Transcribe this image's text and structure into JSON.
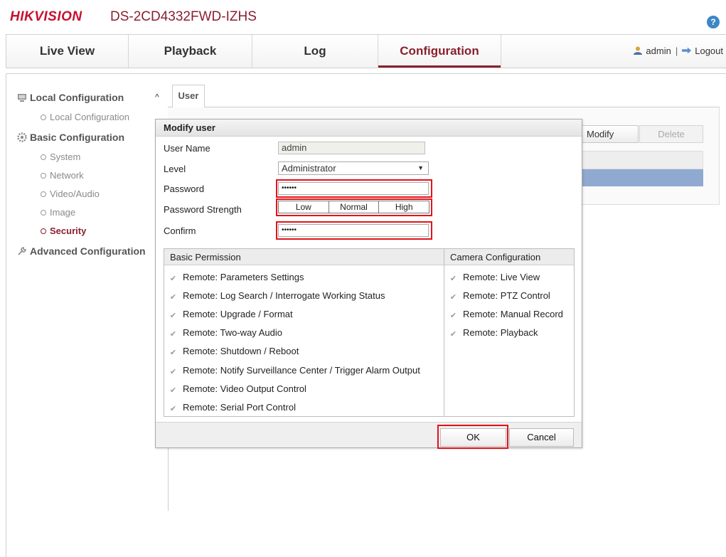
{
  "header": {
    "brand": "HIKVISION",
    "model": "DS-2CD4332FWD-IZHS",
    "help_label": "?"
  },
  "nav": {
    "tabs": [
      "Live View",
      "Playback",
      "Log",
      "Configuration"
    ],
    "active_tab": "Configuration",
    "user": "admin",
    "separator": "|",
    "logout": "Logout"
  },
  "sidebar": {
    "sections": [
      {
        "label": "Local Configuration",
        "items": [
          "Local Configuration"
        ]
      },
      {
        "label": "Basic Configuration",
        "items": [
          "System",
          "Network",
          "Video/Audio",
          "Image",
          "Security"
        ]
      },
      {
        "label": "Advanced Configuration",
        "items": []
      }
    ],
    "active_item": "Security",
    "collapse_caret": "^"
  },
  "content": {
    "tab": "User",
    "modify_button": "Modify",
    "delete_button": "Delete"
  },
  "modal": {
    "title": "Modify user",
    "fields": {
      "username_label": "User Name",
      "username_value": "admin",
      "level_label": "Level",
      "level_value": "Administrator",
      "password_label": "Password",
      "password_value": "••••••",
      "strength_label": "Password Strength",
      "strength_levels": [
        "Low",
        "Normal",
        "High"
      ],
      "confirm_label": "Confirm",
      "confirm_value": "••••••"
    },
    "basic_permission_header": "Basic Permission",
    "camera_config_header": "Camera Configuration",
    "basic_permissions": [
      "Remote: Parameters Settings",
      "Remote: Log Search / Interrogate Working Status",
      "Remote: Upgrade / Format",
      "Remote: Two-way Audio",
      "Remote: Shutdown / Reboot",
      "Remote: Notify Surveillance Center / Trigger Alarm Output",
      "Remote: Video Output Control",
      "Remote: Serial Port Control"
    ],
    "camera_permissions": [
      "Remote: Live View",
      "Remote: PTZ Control",
      "Remote: Manual Record",
      "Remote: Playback"
    ],
    "ok_button": "OK",
    "cancel_button": "Cancel"
  },
  "colors": {
    "brand_red": "#c8102e",
    "active_accent": "#8a1f2e",
    "highlight_red": "#e3121b",
    "selected_row": "#8fa9d0"
  }
}
